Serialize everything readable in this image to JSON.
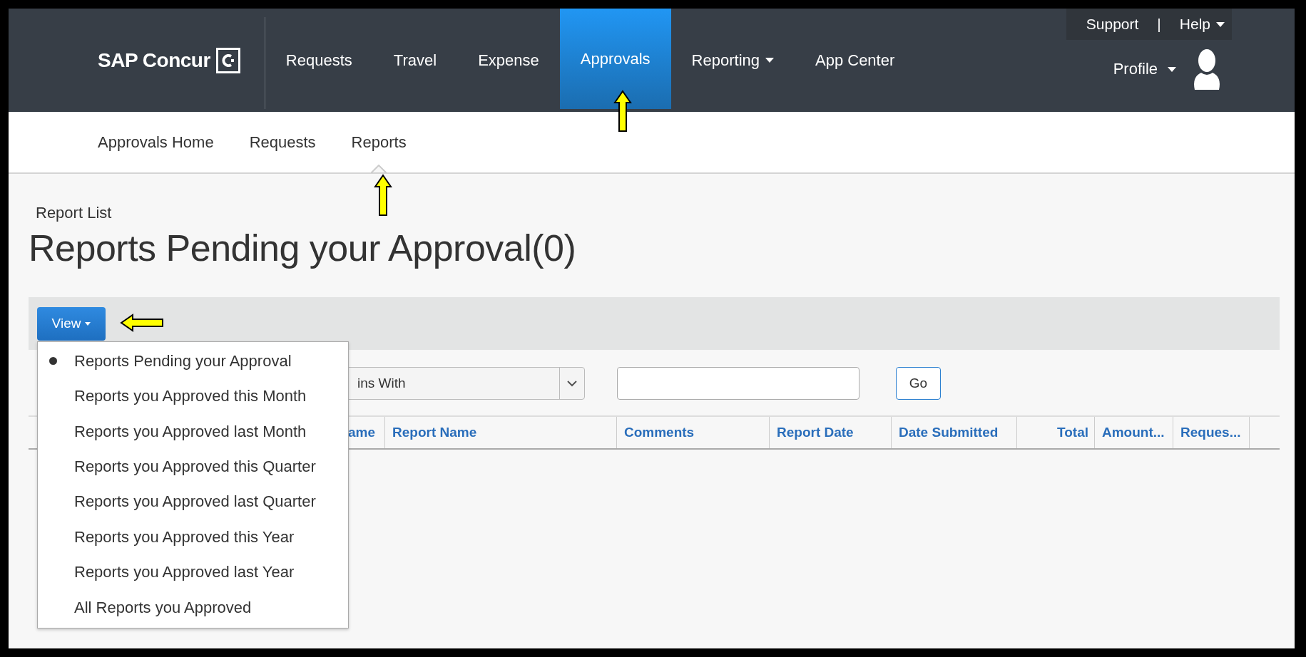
{
  "header": {
    "brand": "SAP Concur",
    "nav": [
      {
        "label": "Requests",
        "selected": false,
        "has_menu": false
      },
      {
        "label": "Travel",
        "selected": false,
        "has_menu": false
      },
      {
        "label": "Expense",
        "selected": false,
        "has_menu": false
      },
      {
        "label": "Approvals",
        "selected": true,
        "has_menu": false
      },
      {
        "label": "Reporting",
        "selected": false,
        "has_menu": true
      },
      {
        "label": "App Center",
        "selected": false,
        "has_menu": false
      }
    ],
    "utility_links": [
      {
        "label": "Support",
        "has_menu": false
      },
      {
        "label": "Help",
        "has_menu": true
      }
    ],
    "utility_separator": "|",
    "profile": {
      "label": "Profile",
      "has_menu": true
    }
  },
  "subnav": [
    {
      "label": "Approvals Home",
      "selected": false
    },
    {
      "label": "Requests",
      "selected": false
    },
    {
      "label": "Reports",
      "selected": true
    }
  ],
  "page": {
    "breadcrumb": "Report List",
    "title": "Reports Pending your Approval(0)"
  },
  "view_button": {
    "label": "View"
  },
  "view_menu": [
    {
      "label": "Reports Pending your Approval",
      "selected": true
    },
    {
      "label": "Reports you Approved this Month",
      "selected": false
    },
    {
      "label": "Reports you Approved last Month",
      "selected": false
    },
    {
      "label": "Reports you Approved this Quarter",
      "selected": false
    },
    {
      "label": "Reports you Approved last Quarter",
      "selected": false
    },
    {
      "label": "Reports you Approved this Year",
      "selected": false
    },
    {
      "label": "Reports you Approved last Year",
      "selected": false
    },
    {
      "label": "All Reports you Approved",
      "selected": false
    }
  ],
  "filter": {
    "condition": "ins With",
    "go_button": "Go"
  },
  "table": {
    "columns": [
      {
        "label": "ame",
        "numeric": false
      },
      {
        "label": "Report Name",
        "numeric": false
      },
      {
        "label": "Comments",
        "numeric": false
      },
      {
        "label": "Report Date",
        "numeric": false
      },
      {
        "label": "Date Submitted",
        "numeric": false
      },
      {
        "label": "Total",
        "numeric": true
      },
      {
        "label": "Amount...",
        "numeric": false
      },
      {
        "label": "Reques...",
        "numeric": false
      }
    ]
  }
}
